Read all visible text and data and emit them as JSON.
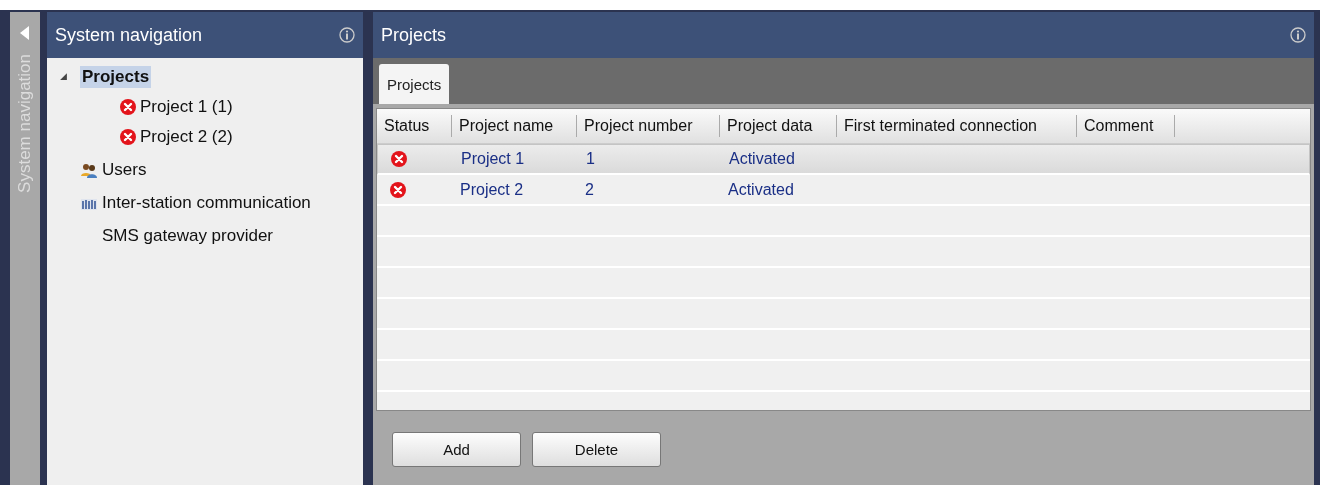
{
  "collapsed_bar": {
    "label": "System navigation"
  },
  "navigation": {
    "title": "System navigation",
    "tree": [
      {
        "label": "Projects",
        "kind": "plain",
        "expanded": true,
        "selected": true,
        "children": [
          {
            "label": "Project 1 (1)",
            "kind": "error",
            "selected": false
          },
          {
            "label": "Project 2 (2)",
            "kind": "error",
            "selected": false
          }
        ]
      },
      {
        "label": "Users",
        "kind": "users",
        "selected": false
      },
      {
        "label": "Inter-station communication",
        "kind": "bars",
        "selected": false
      },
      {
        "label": "SMS gateway provider",
        "kind": "plain",
        "selected": false
      }
    ]
  },
  "main": {
    "title": "Projects",
    "tabs": [
      {
        "label": "Projects",
        "selected": true
      }
    ],
    "table": {
      "columns": [
        "Status",
        "Project name",
        "Project number",
        "Project data",
        "First terminated connection",
        "Comment"
      ],
      "rows": [
        {
          "kind": "error",
          "selected": true,
          "cells": [
            "",
            "Project 1",
            "1",
            "Activated"
          ]
        },
        {
          "kind": "error",
          "selected": false,
          "cells": [
            "",
            "Project 2",
            "2",
            "Activated"
          ]
        }
      ]
    },
    "buttons": [
      "Add",
      "Delete"
    ]
  }
}
